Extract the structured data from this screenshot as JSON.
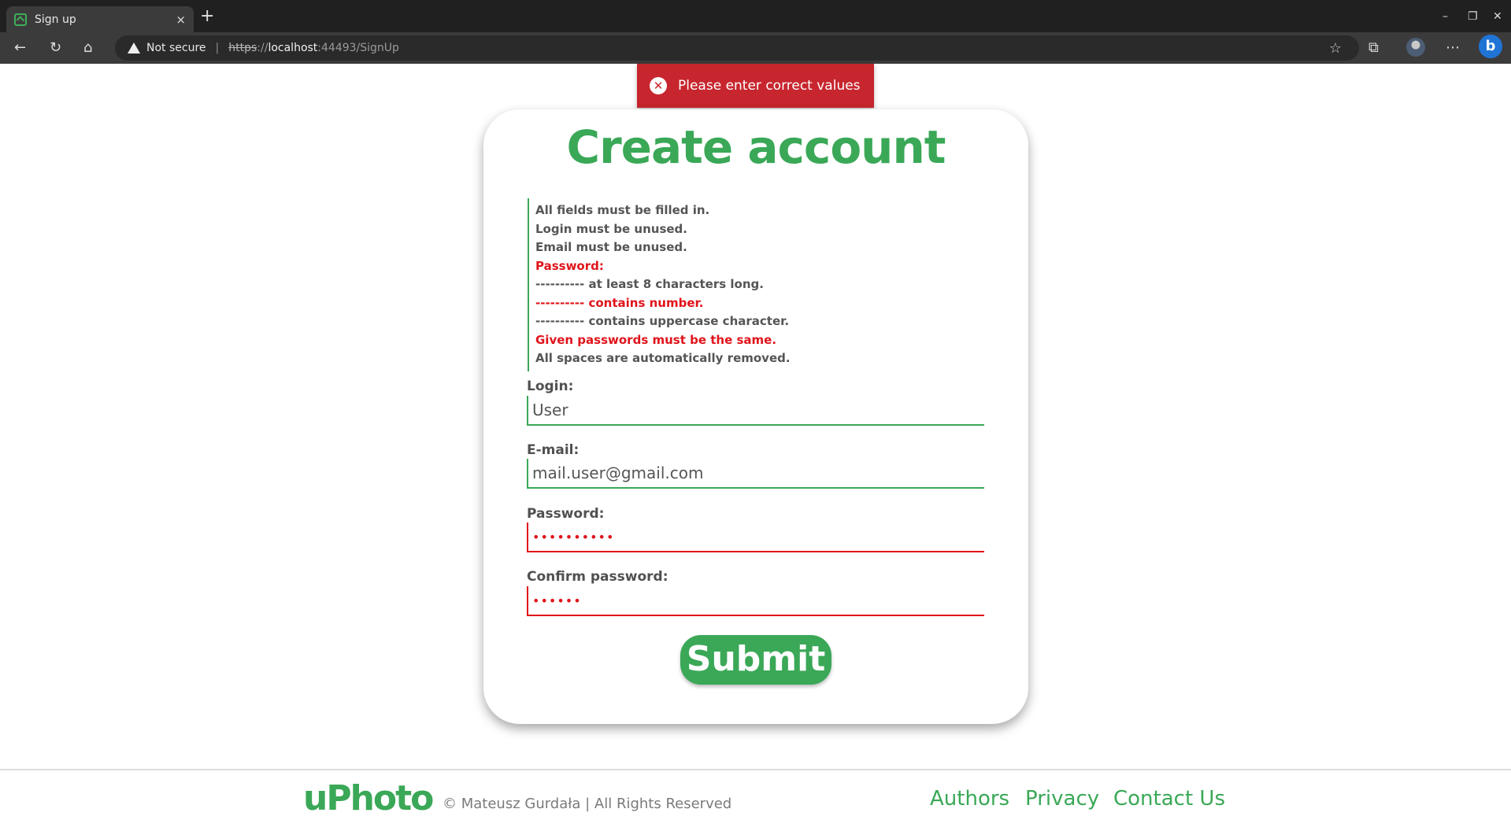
{
  "browser": {
    "tab_title": "Sign up",
    "tab_close": "×",
    "new_tab": "+",
    "security_label": "Not secure",
    "url_scheme": "https",
    "url_sep": "://",
    "url_host": "localhost",
    "url_rest": ":44493/SignUp",
    "minimize": "–",
    "restore": "❐",
    "close": "✕"
  },
  "toast": {
    "icon": "✕",
    "message": "Please enter correct values",
    "color": "#c7262e"
  },
  "form": {
    "title": "Create account",
    "rules": [
      {
        "text": "All fields must be filled in.",
        "error": false
      },
      {
        "text": "Login must be unused.",
        "error": false
      },
      {
        "text": "Email must be unused.",
        "error": false
      },
      {
        "text": "Password:",
        "error": true
      },
      {
        "text": "---------- at least 8 characters long.",
        "error": false
      },
      {
        "text": "---------- contains number.",
        "error": true
      },
      {
        "text": "---------- contains uppercase character.",
        "error": false
      },
      {
        "text": "Given passwords must be the same.",
        "error": true
      },
      {
        "text": "All spaces are automatically removed.",
        "error": false
      }
    ],
    "login_label": "Login:",
    "login_value": "User",
    "email_label": "E-mail:",
    "email_value": "mail.user@gmail.com",
    "password_label": "Password:",
    "password_value": "••••••••••",
    "confirm_label": "Confirm password:",
    "confirm_value": "••••••",
    "submit_label": "Submit",
    "accent_color": "#3aa857",
    "error_color": "#e0141b"
  },
  "footer": {
    "brand": "uPhoto",
    "copyright": "© Mateusz Gurdała | All Rights Reserved",
    "links": [
      "Authors",
      "Privacy",
      "Contact Us"
    ]
  }
}
